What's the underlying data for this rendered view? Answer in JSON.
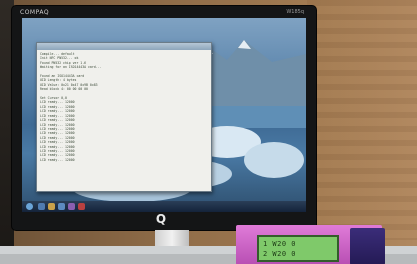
{
  "monitor": {
    "brand_top_left": "COMPAQ",
    "model_top_right": "W185q",
    "logo_glyph": "Q"
  },
  "terminal": {
    "lines": [
      "Compile... default",
      "Init NFC PN532... ok",
      "Found PN532 chip ver 1.6",
      "Waiting for an ISO14443A card...",
      "",
      "Found an ISO14443A card",
      "UID Length: 4 bytes",
      "UID Value: 0x21 0x47 0x9B 0x83",
      "Read block 4: 00 00 00 00",
      "",
      "Set Cursor 0,0",
      "LCD ready... 12000",
      "LCD ready... 12000",
      "LCD ready... 12000",
      "LCD ready... 12000",
      "LCD ready... 12000",
      "LCD ready... 12000",
      "LCD ready... 12000",
      "LCD ready... 12000",
      "LCD ready... 12000",
      "LCD ready... 12000",
      "LCD ready... 12000",
      "LCD ready... 12000",
      "LCD ready... 12000",
      "LCD ready... 12000"
    ]
  },
  "lcd": {
    "line1": "1   W20 0",
    "line2": "2   W20 0"
  },
  "colors": {
    "lcd_green": "#7fc96a",
    "box_pink": "#cf65c8",
    "box_blue": "#2f2268"
  }
}
